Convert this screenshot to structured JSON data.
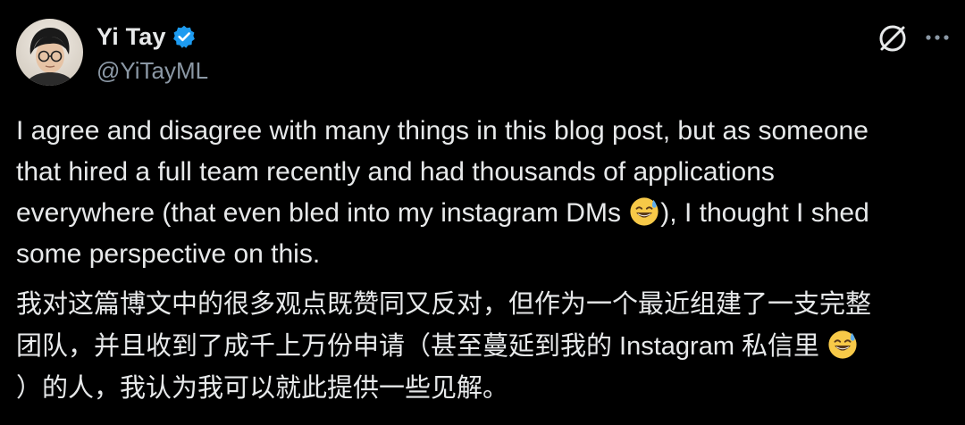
{
  "tweet": {
    "author": {
      "display_name": "Yi Tay",
      "handle": "@YiTayML",
      "verified": true,
      "verified_color": "#1d9bf0"
    },
    "actions": {
      "grok_icon": "grok-icon",
      "more_icon": "more-icon"
    },
    "text_en": {
      "line1": "I agree and disagree with many things in this blog post, but as someone",
      "line2": "that hired a full team recently and had thousands of applications",
      "line3_a": "everywhere (that even bled into my instagram DMs ",
      "line3_b": "), I thought I shed",
      "line4": "some perspective on this."
    },
    "text_zh": {
      "line1": "我对这篇博文中的很多观点既赞同又反对，但作为一个最近组建了一支完整",
      "line2": "团队，并且收到了成千上万份申请（甚至蔓延到我的 Instagram 私信里 ",
      "line3": "）的人，我认为我可以就此提供一些见解。"
    },
    "emoji": "grinning-face-with-sweat",
    "colors": {
      "background": "#000000",
      "text": "#e7e9ea",
      "secondary": "#8b98a5"
    }
  }
}
